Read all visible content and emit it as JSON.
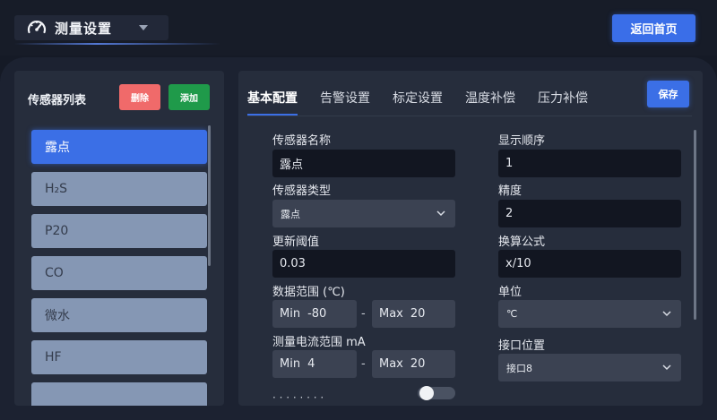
{
  "header": {
    "title": "测量设置",
    "home_button": "返回首页"
  },
  "sensor_panel": {
    "title": "传感器列表",
    "delete_label": "删除",
    "add_label": "添加",
    "items": [
      {
        "label": "露点",
        "active": true
      },
      {
        "label": "H₂S"
      },
      {
        "label": "P20"
      },
      {
        "label": "CO"
      },
      {
        "label": "微水"
      },
      {
        "label": "HF"
      },
      {
        "label": ""
      }
    ]
  },
  "config": {
    "tabs": [
      "基本配置",
      "告警设置",
      "标定设置",
      "温度补偿",
      "压力补偿"
    ],
    "active_tab": 0,
    "save_label": "保存",
    "sensor_name": {
      "label": "传感器名称",
      "value": "露点"
    },
    "display_order": {
      "label": "显示顺序",
      "value": "1"
    },
    "sensor_type": {
      "label": "传感器类型",
      "value": "露点"
    },
    "precision": {
      "label": "精度",
      "value": "2"
    },
    "update_threshold": {
      "label": "更新阈值",
      "value": "0.03"
    },
    "formula": {
      "label": "换算公式",
      "value": "x/10"
    },
    "data_range": {
      "label": "数据范围 (℃)",
      "min_label": "Min",
      "min_value": "-80",
      "max_label": "Max",
      "max_value": "20"
    },
    "unit": {
      "label": "单位",
      "value": "℃"
    },
    "current_range": {
      "label": "测量电流范围 mA",
      "min_label": "Min",
      "min_value": "4",
      "max_label": "Max",
      "max_value": "20"
    },
    "port": {
      "label": "接口位置",
      "value": "接口8"
    },
    "range_separator": "-"
  }
}
